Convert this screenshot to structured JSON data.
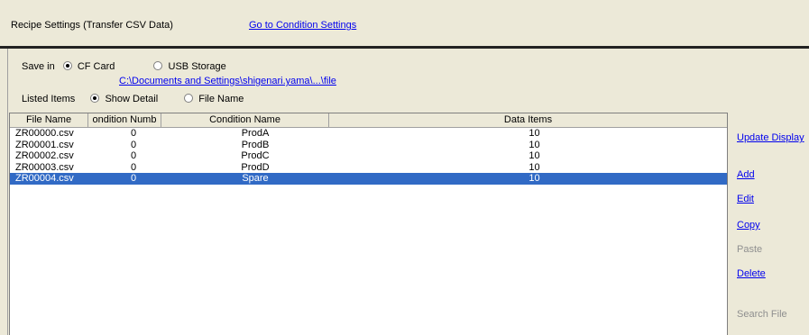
{
  "header": {
    "title": "Recipe Settings (Transfer CSV Data)",
    "condition_link": "Go to Condition Settings"
  },
  "save_in": {
    "label": "Save in",
    "options": [
      "CF Card",
      "USB Storage"
    ],
    "selected": "CF Card",
    "path": "C:\\Documents and Settings\\shigenari.yama\\...\\file"
  },
  "listed_items": {
    "label": "Listed Items",
    "options": [
      "Show Detail",
      "File Name"
    ],
    "selected": "Show Detail"
  },
  "table": {
    "columns": [
      "File Name",
      "ondition Numb",
      "Condition Name",
      "Data Items"
    ],
    "rows": [
      {
        "file": "ZR00000.csv",
        "num": "0",
        "name": "ProdA",
        "items": "10"
      },
      {
        "file": "ZR00001.csv",
        "num": "0",
        "name": "ProdB",
        "items": "10"
      },
      {
        "file": "ZR00002.csv",
        "num": "0",
        "name": "ProdC",
        "items": "10"
      },
      {
        "file": "ZR00003.csv",
        "num": "0",
        "name": "ProdD",
        "items": "10"
      },
      {
        "file": "ZR00004.csv",
        "num": "0",
        "name": "Spare",
        "items": "10"
      }
    ],
    "selected_index": 4
  },
  "actions": {
    "update_display": "Update Display",
    "add": "Add",
    "edit": "Edit",
    "copy": "Copy",
    "paste": "Paste",
    "delete": "Delete",
    "search_file": "Search File"
  },
  "colors": {
    "background": "#ece9d8",
    "selection": "#316ac5",
    "link": "#0000ee",
    "disabled": "#8f8f8f"
  }
}
